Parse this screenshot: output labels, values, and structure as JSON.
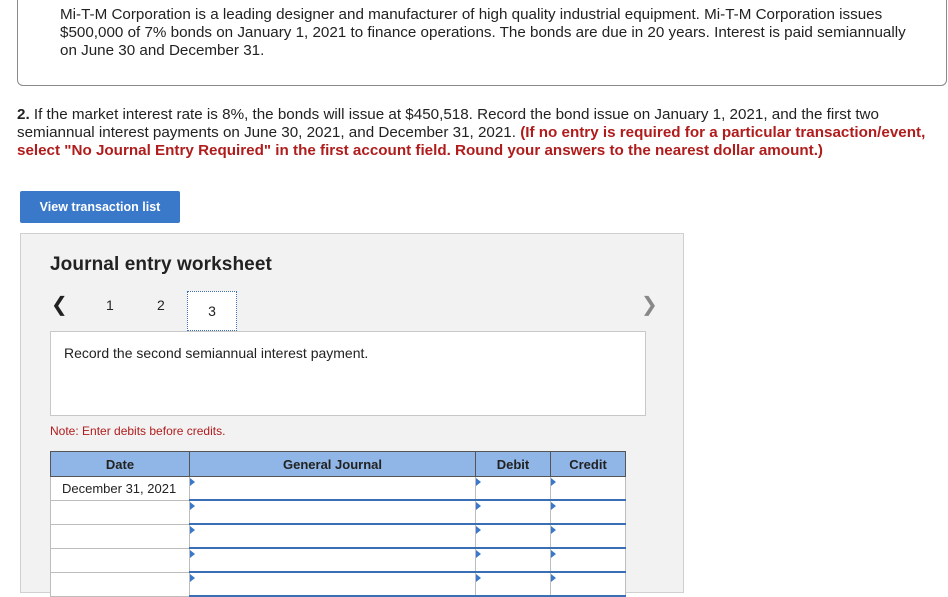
{
  "intro": {
    "text": "Mi-T-M Corporation is a leading designer and manufacturer of high quality industrial equipment.  Mi-T-M Corporation issues $500,000 of 7% bonds on January 1, 2021 to finance operations.  The bonds are due in 20 years.  Interest is paid semiannually on June 30 and December 31."
  },
  "question": {
    "number": "2.",
    "text": " If the market interest rate is 8%, the bonds will issue at $450,518. Record the bond issue on January 1, 2021, and the first two semiannual interest payments on June 30, 2021, and December 31, 2021. ",
    "instruction": "(If no entry is required for a particular transaction/event, select \"No Journal Entry Required\" in the first account field. Round your answers to the nearest dollar amount.)"
  },
  "view_button": {
    "label": "View transaction list"
  },
  "worksheet": {
    "title": "Journal entry worksheet",
    "prev_icon": "chevron-left-icon",
    "next_icon": "chevron-right-icon",
    "pages": [
      "1",
      "2",
      "3"
    ],
    "active_page": "3",
    "prompt": "Record the second semiannual interest payment.",
    "note": "Note: Enter debits before credits.",
    "columns": [
      "Date",
      "General Journal",
      "Debit",
      "Credit"
    ],
    "rows": [
      {
        "date": "December 31, 2021",
        "account": "",
        "debit": "",
        "credit": ""
      },
      {
        "date": "",
        "account": "",
        "debit": "",
        "credit": ""
      },
      {
        "date": "",
        "account": "",
        "debit": "",
        "credit": ""
      },
      {
        "date": "",
        "account": "",
        "debit": "",
        "credit": ""
      },
      {
        "date": "",
        "account": "",
        "debit": "",
        "credit": ""
      }
    ]
  },
  "colors": {
    "button": "#3a78c9",
    "header": "#8fb6e6",
    "instruction": "#b01c1c"
  }
}
